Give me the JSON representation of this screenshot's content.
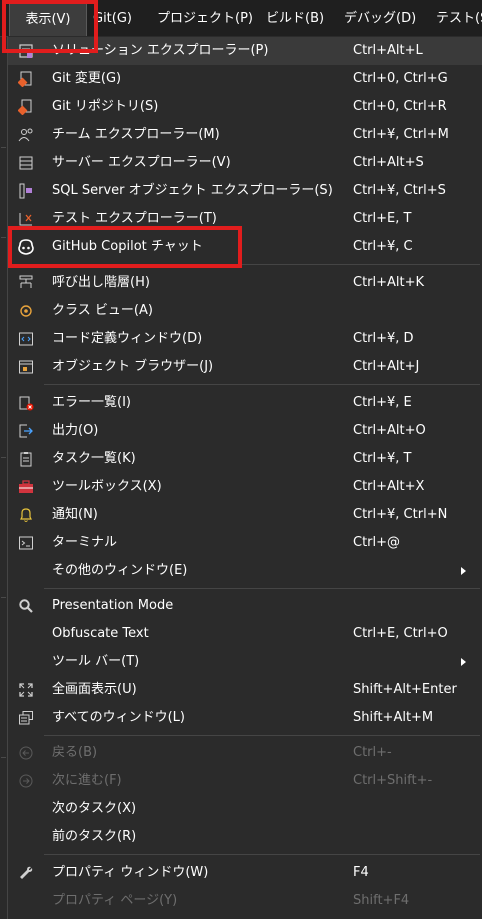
{
  "menubar": {
    "items": [
      {
        "label": "表示(V)"
      },
      {
        "label": "Git(G)"
      },
      {
        "label": "プロジェクト(P)"
      },
      {
        "label": "ビルド(B)"
      },
      {
        "label": "デバッグ(D)"
      },
      {
        "label": "テスト(S"
      }
    ]
  },
  "menu": {
    "group1": [
      {
        "label": "ソリューション エクスプローラー(P)",
        "shortcut": "Ctrl+Alt+L",
        "icon": "solution-explorer-icon"
      },
      {
        "label": "Git 変更(G)",
        "shortcut": "Ctrl+0, Ctrl+G",
        "icon": "git-changes-icon"
      },
      {
        "label": "Git リポジトリ(S)",
        "shortcut": "Ctrl+0, Ctrl+R",
        "icon": "git-repository-icon"
      },
      {
        "label": "チーム エクスプローラー(M)",
        "shortcut": "Ctrl+¥, Ctrl+M",
        "icon": "team-explorer-icon"
      },
      {
        "label": "サーバー エクスプローラー(V)",
        "shortcut": "Ctrl+Alt+S",
        "icon": "server-explorer-icon"
      },
      {
        "label": "SQL Server オブジェクト エクスプローラー(S)",
        "shortcut": "Ctrl+¥, Ctrl+S",
        "icon": "sql-server-icon"
      },
      {
        "label": "テスト エクスプローラー(T)",
        "shortcut": "Ctrl+E, T",
        "icon": "test-explorer-icon"
      },
      {
        "label": "GitHub Copilot チャット",
        "shortcut": "Ctrl+¥, C",
        "icon": "copilot-icon"
      }
    ],
    "group2": [
      {
        "label": "呼び出し階層(H)",
        "shortcut": "Ctrl+Alt+K",
        "icon": "call-hierarchy-icon"
      },
      {
        "label": "クラス ビュー(A)",
        "shortcut": "",
        "icon": "class-view-icon"
      },
      {
        "label": "コード定義ウィンドウ(D)",
        "shortcut": "Ctrl+¥, D",
        "icon": "code-definition-icon"
      },
      {
        "label": "オブジェクト ブラウザー(J)",
        "shortcut": "Ctrl+Alt+J",
        "icon": "object-browser-icon"
      }
    ],
    "group3": [
      {
        "label": "エラー一覧(I)",
        "shortcut": "Ctrl+¥, E",
        "icon": "error-list-icon"
      },
      {
        "label": "出力(O)",
        "shortcut": "Ctrl+Alt+O",
        "icon": "output-icon"
      },
      {
        "label": "タスク一覧(K)",
        "shortcut": "Ctrl+¥, T",
        "icon": "task-list-icon"
      },
      {
        "label": "ツールボックス(X)",
        "shortcut": "Ctrl+Alt+X",
        "icon": "toolbox-icon"
      },
      {
        "label": "通知(N)",
        "shortcut": "Ctrl+¥, Ctrl+N",
        "icon": "bell-icon"
      },
      {
        "label": "ターミナル",
        "shortcut": "Ctrl+@",
        "icon": "terminal-icon"
      },
      {
        "label": "その他のウィンドウ(E)",
        "shortcut": "",
        "icon": ""
      }
    ],
    "group4": [
      {
        "label": "Presentation Mode",
        "shortcut": "",
        "icon": "magnifier-icon"
      },
      {
        "label": "Obfuscate Text",
        "shortcut": "Ctrl+E, Ctrl+O",
        "icon": ""
      },
      {
        "label": "ツール バー(T)",
        "shortcut": "",
        "icon": ""
      },
      {
        "label": "全画面表示(U)",
        "shortcut": "Shift+Alt+Enter",
        "icon": "fullscreen-icon"
      },
      {
        "label": "すべてのウィンドウ(L)",
        "shortcut": "Shift+Alt+M",
        "icon": "all-windows-icon"
      }
    ],
    "group5": [
      {
        "label": "戻る(B)",
        "shortcut": "Ctrl+-",
        "icon": "back-icon"
      },
      {
        "label": "次に進む(F)",
        "shortcut": "Ctrl+Shift+-",
        "icon": "forward-icon"
      },
      {
        "label": "次のタスク(X)",
        "shortcut": "",
        "icon": ""
      },
      {
        "label": "前のタスク(R)",
        "shortcut": "",
        "icon": ""
      }
    ],
    "group6": [
      {
        "label": "プロパティ ウィンドウ(W)",
        "shortcut": "F4",
        "icon": "wrench-icon"
      },
      {
        "label": "プロパティ ページ(Y)",
        "shortcut": "Shift+F4",
        "icon": ""
      }
    ]
  },
  "colors": {
    "highlight_box": "#e11d1d",
    "menu_bg": "#2b2b2b",
    "disabled_text": "#6e6e6e"
  }
}
